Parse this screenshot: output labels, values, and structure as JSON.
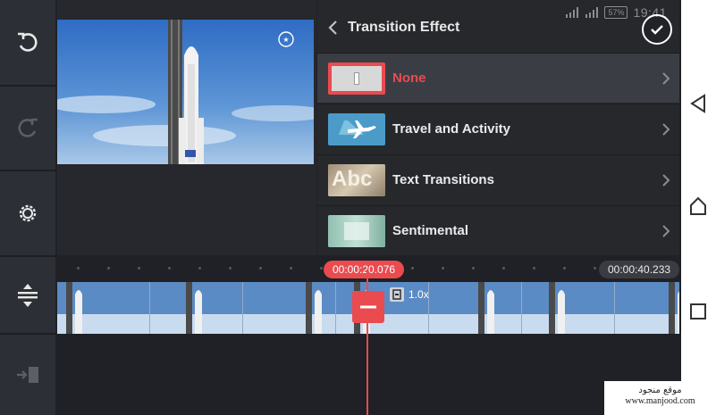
{
  "panel": {
    "title": "Transition Effect",
    "status": {
      "battery": "57%",
      "time": "19:41"
    },
    "effects": [
      {
        "label": "None",
        "selected": true
      },
      {
        "label": "Travel and Activity",
        "selected": false
      },
      {
        "label": "Text Transitions",
        "thumb_text": "Abc",
        "selected": false
      },
      {
        "label": "Sentimental",
        "selected": false
      }
    ]
  },
  "timeline": {
    "current_time": "00:00:20.076",
    "total_time": "00:00:40.233",
    "speed": "1.0x"
  },
  "watermark": {
    "line1": "موقع منجود",
    "line2": "www.manjood.com"
  },
  "colors": {
    "accent": "#ea4b4f",
    "background": "#1f2126",
    "panel": "#26282c",
    "selected_row": "#3b3d44"
  }
}
